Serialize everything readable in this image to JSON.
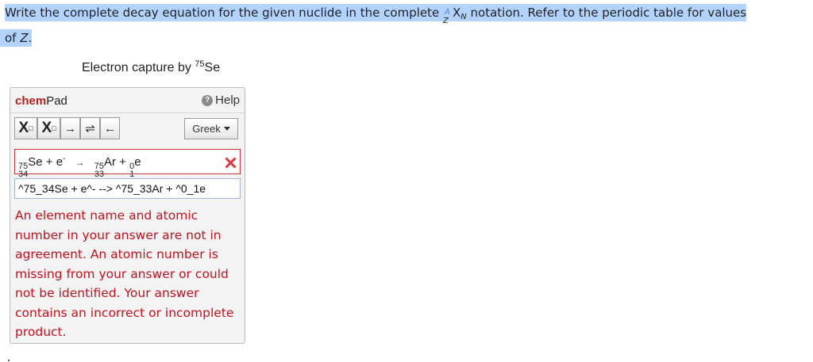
{
  "question": {
    "line1_prefix": "Write the complete decay equation for the given nuclide in the complete ",
    "notation_A": "A",
    "notation_Z": "Z",
    "notation_X": "X",
    "notation_N": "N",
    "line1_suffix": " notation. Refer to the periodic table for values",
    "line2_prefix": "of ",
    "line2_var": "Z",
    "line2_suffix": "."
  },
  "prompt": {
    "text": "Electron capture by ",
    "mass": "75",
    "element": "Se"
  },
  "chempad": {
    "title_part1": "chem",
    "title_part2": "Pad",
    "help_label": "Help",
    "help_glyph": "?",
    "toolbar": {
      "sub_glyph": "X",
      "sub_box": "□",
      "sup_glyph": "X",
      "sup_box": "□",
      "arrow_right": "→",
      "arrow_equilibrium": "⇌",
      "arrow_left": "←",
      "greek_label": "Greek"
    },
    "equation": {
      "r1_mass": "75",
      "r1_atomic": "34",
      "r1_symbol": "Se",
      "plus1": "+",
      "r2_symbol": "e",
      "r2_charge": "-",
      "arrow": "→",
      "p1_mass": "75",
      "p1_atomic": "33",
      "p1_symbol": "Ar",
      "plus2": "+",
      "p2_mass": "0",
      "p2_atomic": "1",
      "p2_symbol": "e"
    },
    "text_input_value": "^75_34Se + e^- --> ^75_33Ar + ^0_1e",
    "feedback": "An element name and atomic number in your answer are not in agreement. An atomic number is missing from your answer or could not be identified. Your answer contains an incorrect or incomplete product."
  },
  "colors": {
    "highlight": "#b3d3ff",
    "brand_red": "#b8201e",
    "error_red": "#c0121f",
    "panel_bg": "#f3f3f3"
  }
}
